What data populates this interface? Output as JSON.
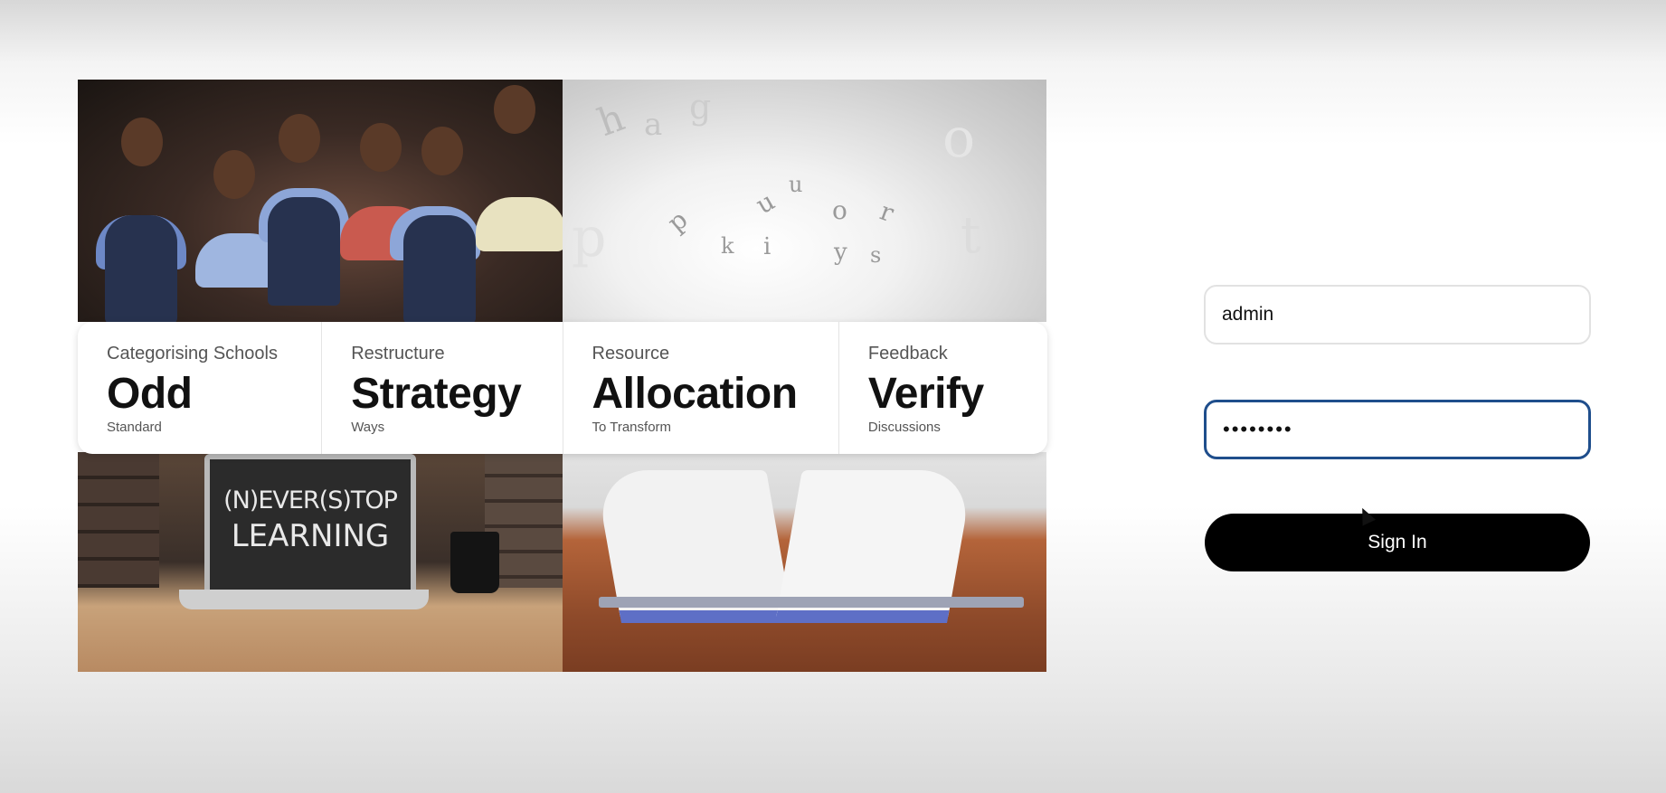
{
  "hero": {
    "laptop_text_line1": "(N)EVER(S)TOP",
    "laptop_text_line2": "LEARNING",
    "letters": [
      "h",
      "a",
      "g",
      "i",
      "u",
      "o",
      "k",
      "y",
      "s",
      "t",
      "r",
      "p"
    ]
  },
  "cards": [
    {
      "label": "Categorising Schools",
      "title": "Odd",
      "subtitle": "Standard"
    },
    {
      "label": "Restructure",
      "title": "Strategy",
      "subtitle": "Ways"
    },
    {
      "label": "Resource",
      "title": "Allocation",
      "subtitle": "To Transform"
    },
    {
      "label": "Feedback",
      "title": "Verify",
      "subtitle": "Discussions"
    }
  ],
  "login": {
    "username_value": "admin",
    "password_value": "••••••••",
    "signin_label": "Sign In"
  },
  "colors": {
    "button_bg": "#000000",
    "focus_border": "#1f4e8c"
  }
}
